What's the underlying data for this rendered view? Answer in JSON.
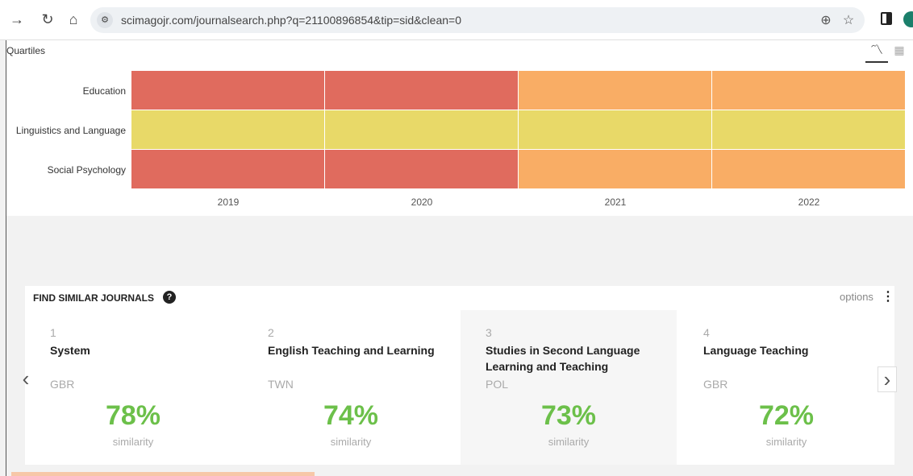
{
  "browser": {
    "url": "scimagojr.com/journalsearch.php?q=21100896854&tip=sid&clean=0",
    "icons": [
      "forward-icon",
      "reload-icon",
      "home-icon",
      "site-info-icon",
      "zoom-icon",
      "bookmark-star-icon",
      "side-panel-icon",
      "profile-avatar"
    ]
  },
  "quartiles": {
    "title": "Quartiles",
    "rows": [
      "Education",
      "Linguistics and Language",
      "Social Psychology"
    ],
    "years": [
      "2019",
      "2020",
      "2021",
      "2022"
    ],
    "colors": {
      "Q1": "#e8d968",
      "Q2": "#f9ad65",
      "Q3": "#e06b5e"
    }
  },
  "chart_data": {
    "type": "heatmap",
    "title": "Quartiles",
    "rows": [
      "Education",
      "Linguistics and Language",
      "Social Psychology"
    ],
    "columns": [
      "2019",
      "2020",
      "2021",
      "2022"
    ],
    "values": [
      [
        "Q3",
        "Q3",
        "Q2",
        "Q2"
      ],
      [
        "Q1",
        "Q1",
        "Q1",
        "Q1"
      ],
      [
        "Q3",
        "Q3",
        "Q2",
        "Q2"
      ]
    ]
  },
  "similar": {
    "heading": "FIND SIMILAR JOURNALS",
    "help": "?",
    "options_label": "options",
    "similarity_label": "similarity",
    "journals": [
      {
        "rank": "1",
        "title": "System",
        "country": "GBR",
        "similarity": "78%"
      },
      {
        "rank": "2",
        "title": "English Teaching and Learning",
        "country": "TWN",
        "similarity": "74%"
      },
      {
        "rank": "3",
        "title": "Studies in Second Language Learning and Teaching",
        "country": "POL",
        "similarity": "73%"
      },
      {
        "rank": "4",
        "title": "Language Teaching",
        "country": "GBR",
        "similarity": "72%"
      }
    ]
  }
}
